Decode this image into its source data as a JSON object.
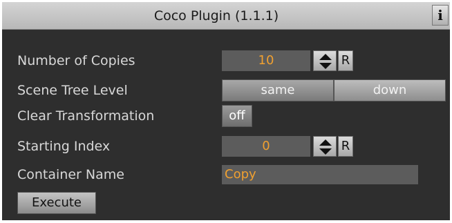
{
  "window": {
    "title": "Coco Plugin (1.1.1)",
    "info_icon_glyph": "i",
    "info_icon": "info-icon"
  },
  "fields": {
    "copies": {
      "label": "Number of Copies",
      "value": "10",
      "reset_label": "R"
    },
    "scene_tree_level": {
      "label": "Scene Tree Level",
      "options": [
        "same",
        "down"
      ],
      "selected": "same"
    },
    "clear_transformation": {
      "label": "Clear Transformation",
      "value": "off"
    },
    "starting_index": {
      "label": "Starting Index",
      "value": "0",
      "reset_label": "R"
    },
    "container_name": {
      "label": "Container Name",
      "value": "Copy"
    }
  },
  "actions": {
    "execute_label": "Execute"
  },
  "colors": {
    "panel_bg": "#2e2e2e",
    "label_text": "#d8d8d8",
    "value_accent": "#f0a030",
    "field_bg": "#5c5c5c"
  }
}
